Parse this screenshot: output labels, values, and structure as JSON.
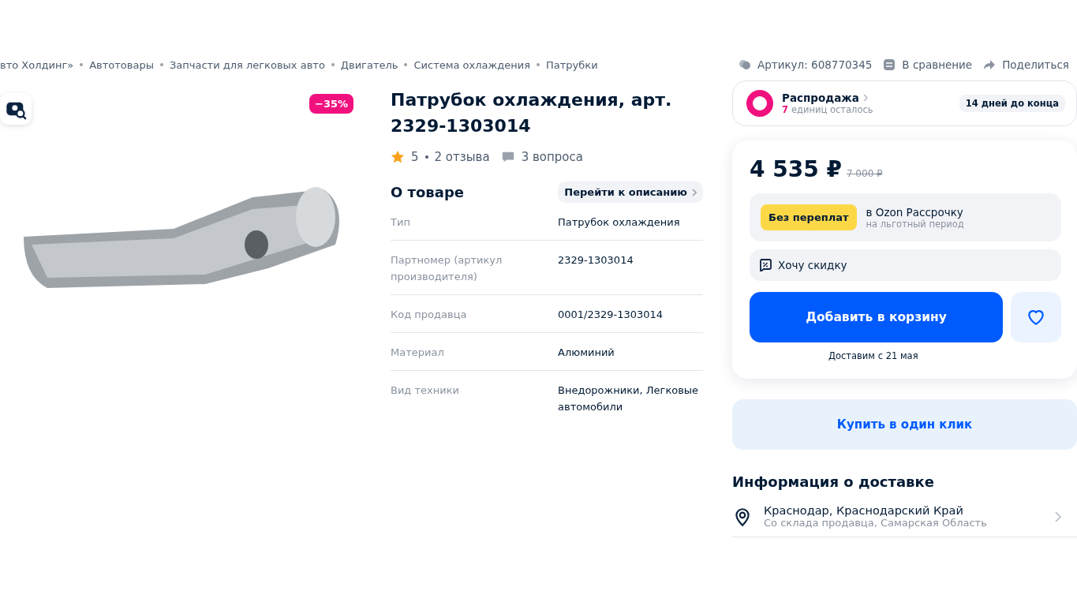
{
  "breadcrumbs": [
    "вто Холдинг»",
    "Автотовары",
    "Запчасти для легковых авто",
    "Двигатель",
    "Система охлаждения",
    "Патрубки"
  ],
  "actions": [
    {
      "kind": "article",
      "label": "Артикул: 608770345"
    },
    {
      "kind": "compare",
      "label": "В сравнение"
    },
    {
      "kind": "share",
      "label": "Поделиться"
    }
  ],
  "gallery": {
    "discount_badge": "−35%"
  },
  "product": {
    "title": "Патрубок охлаждения, арт. 2329-1303014",
    "rating": "5",
    "reviews": "2 отзыва",
    "questions": "3 вопроса"
  },
  "about": {
    "heading": "О товаре",
    "link": "Перейти к описанию",
    "specs": [
      {
        "name": "Тип",
        "value": "Патрубок охлаждения"
      },
      {
        "name": "Партномер (артикул производителя)",
        "value": "2329-1303014"
      },
      {
        "name": "Код продавца",
        "value": "0001/2329-1303014"
      },
      {
        "name": "Материал",
        "value": "Алюминий"
      },
      {
        "name": "Вид техники",
        "value": "Внедорожники, Легковые автомобили"
      }
    ]
  },
  "sale": {
    "title": "Распродажа",
    "count": "7",
    "count_text": "единиц осталось",
    "deadline": "14 дней до конца"
  },
  "price": {
    "current": "4 535 ₽",
    "old": "7 000 ₽"
  },
  "installment": {
    "badge": "Без переплат",
    "title": "в Ozon Рассрочку",
    "subtitle": "на льготный период"
  },
  "discount_request": "Хочу скидку",
  "cart_button": "Добавить в корзину",
  "delivery_date": "Доставим с 21 мая",
  "one_click_button": "Купить в один клик",
  "delivery": {
    "heading": "Информация о доставке",
    "items": [
      {
        "title": "Краснодар, Краснодарский Край",
        "subtitle": "Со склада продавца, Самарская Область"
      }
    ]
  }
}
